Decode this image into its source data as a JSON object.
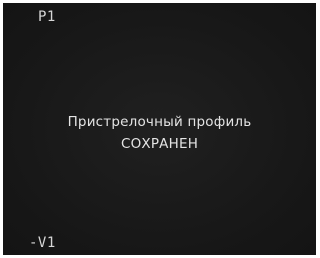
{
  "osd": {
    "profile_slot": "P1",
    "vertical_offset": "-V1",
    "message_line1": "Пристрелочный профиль",
    "message_line2": "СОХРАНЕН"
  },
  "colors": {
    "background": "#1a1a1a",
    "text": "#e0e0e0"
  }
}
